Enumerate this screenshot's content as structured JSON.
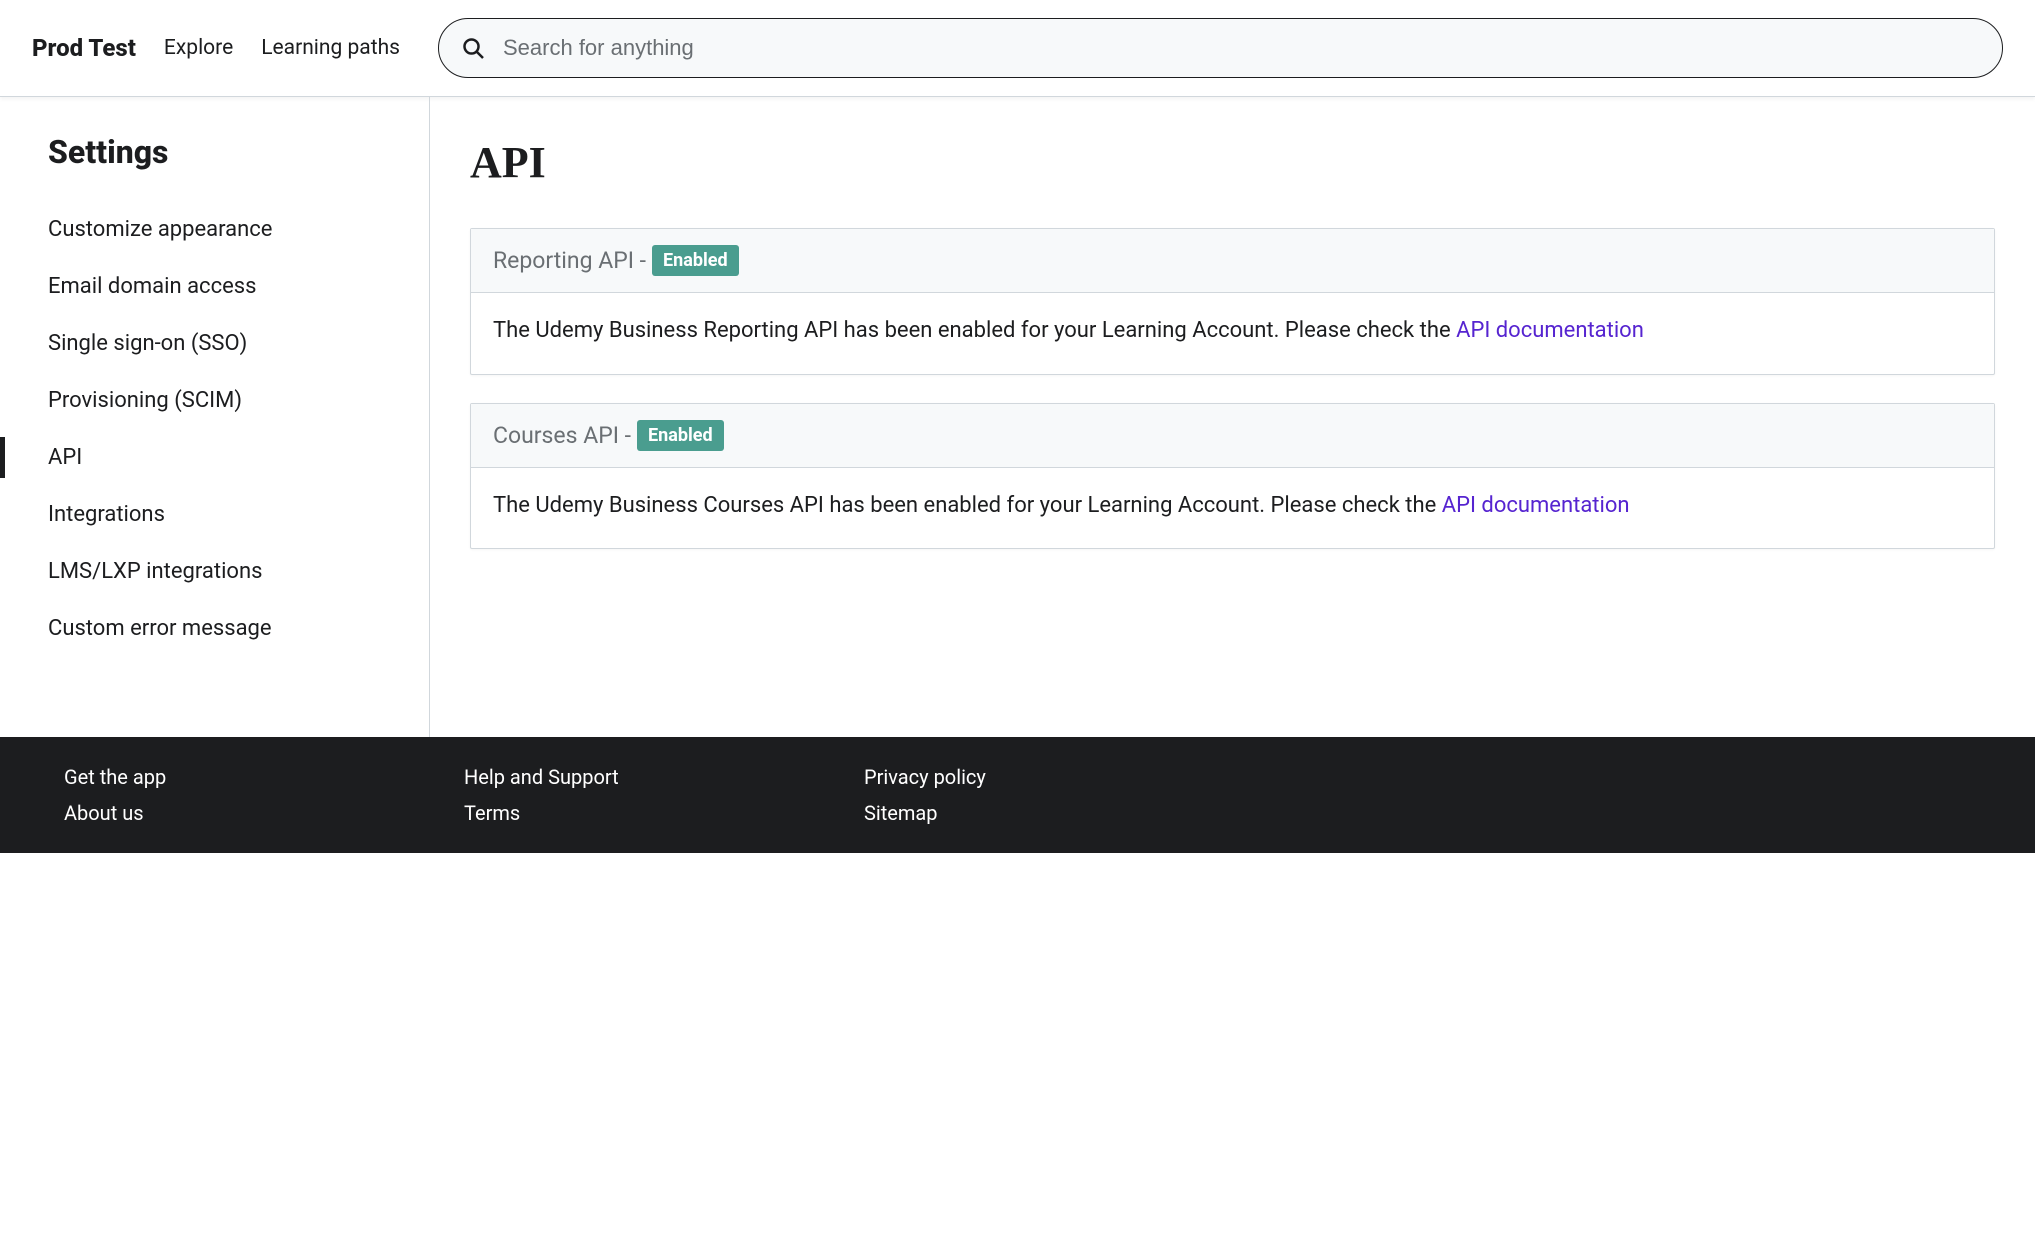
{
  "header": {
    "brand": "Prod Test",
    "nav": {
      "explore": "Explore",
      "learning_paths": "Learning paths"
    },
    "search": {
      "placeholder": "Search for anything"
    }
  },
  "sidebar": {
    "title": "Settings",
    "items": [
      {
        "label": "Customize appearance"
      },
      {
        "label": "Email domain access"
      },
      {
        "label": "Single sign-on (SSO)"
      },
      {
        "label": "Provisioning (SCIM)"
      },
      {
        "label": "API",
        "active": true
      },
      {
        "label": "Integrations"
      },
      {
        "label": "LMS/LXP integrations"
      },
      {
        "label": "Custom error message"
      }
    ]
  },
  "main": {
    "title": "API",
    "cards": [
      {
        "header_prefix": "Reporting API - ",
        "badge": "Enabled",
        "body_text": "The Udemy Business Reporting API has been enabled for your Learning Account. Please check the ",
        "link_text": "API documentation"
      },
      {
        "header_prefix": "Courses API - ",
        "badge": "Enabled",
        "body_text": "The Udemy Business Courses API has been enabled for your Learning Account. Please check the ",
        "link_text": "API documentation"
      }
    ]
  },
  "footer": {
    "col1": [
      "Get the app",
      "About us"
    ],
    "col2": [
      "Help and Support",
      "Terms"
    ],
    "col3": [
      "Privacy policy",
      "Sitemap"
    ]
  }
}
